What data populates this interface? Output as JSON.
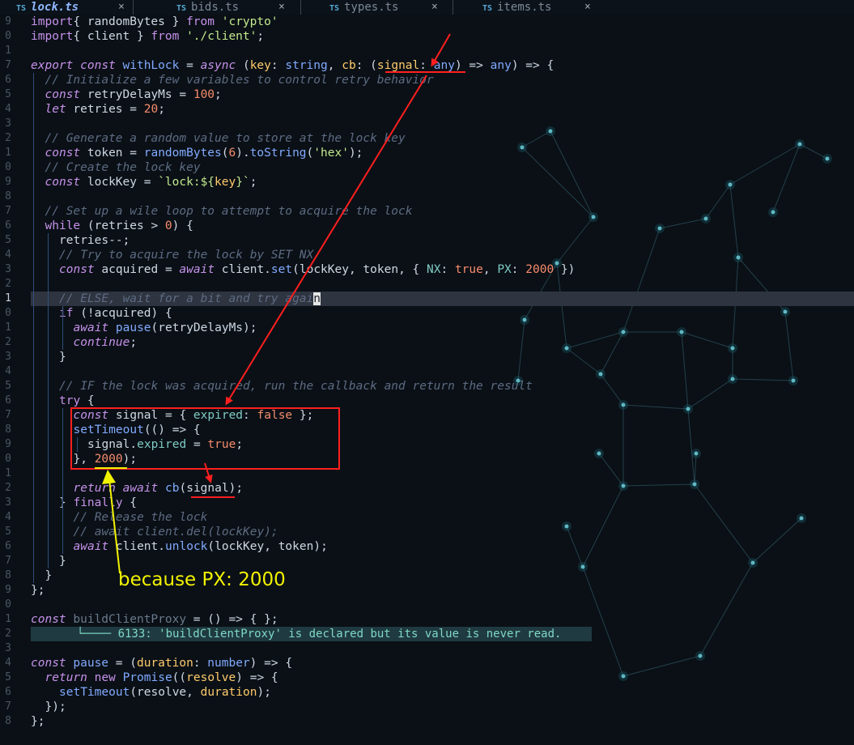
{
  "tabs": [
    {
      "badge": "TS",
      "name": "lock.ts",
      "close": "×",
      "active": true
    },
    {
      "badge": "TS",
      "name": "bids.ts",
      "close": "×",
      "active": false
    },
    {
      "badge": "TS",
      "name": "types.ts",
      "close": "×",
      "active": false
    },
    {
      "badge": "TS",
      "name": "items.ts",
      "close": "×",
      "active": false
    }
  ],
  "gutter": [
    "9",
    "0",
    "1",
    "7",
    "6",
    "5",
    "4",
    "3",
    "2",
    "1",
    "0",
    "9",
    "8",
    "7",
    "6",
    "5",
    "4",
    "3",
    "2",
    "1",
    "0",
    "1",
    "2",
    "3",
    "4",
    "5",
    "6",
    "7",
    "8",
    "9",
    "0",
    "1",
    "2",
    "3",
    "4",
    "5",
    "6",
    "7",
    "8",
    "9",
    "0",
    "1",
    "2",
    "3",
    "4",
    "5",
    "6",
    "7",
    "8"
  ],
  "code_lines": [
    [
      [
        "kw",
        "import"
      ],
      [
        "",
        "{ randomBytes } "
      ],
      [
        "kw",
        "from"
      ],
      [
        "",
        " "
      ],
      [
        "s",
        "'crypto'"
      ]
    ],
    [
      [
        "kw",
        "import"
      ],
      [
        "",
        "{ client } "
      ],
      [
        "kw",
        "from"
      ],
      [
        "",
        " "
      ],
      [
        "s",
        "'./client'"
      ],
      [
        "",
        ";"
      ]
    ],
    [],
    [
      [
        "k",
        "export"
      ],
      [
        "",
        " "
      ],
      [
        "k",
        "const"
      ],
      [
        "",
        " "
      ],
      [
        "f",
        "withLock"
      ],
      [
        "",
        " = "
      ],
      [
        "k",
        "async"
      ],
      [
        "",
        " ("
      ],
      [
        "p",
        "key"
      ],
      [
        "",
        ": "
      ],
      [
        "t",
        "string"
      ],
      [
        "",
        ", "
      ],
      [
        "p",
        "cb"
      ],
      [
        "",
        ": ("
      ],
      [
        "p",
        "signal"
      ],
      [
        "",
        ": "
      ],
      [
        "t",
        "any"
      ],
      [
        "",
        ") => "
      ],
      [
        "t",
        "any"
      ],
      [
        "",
        ") => {"
      ]
    ],
    [
      [
        "c",
        "// Initialize a few variables to control retry behavior"
      ]
    ],
    [
      [
        "k",
        "const"
      ],
      [
        "",
        " retryDelayMs = "
      ],
      [
        "n",
        "100"
      ],
      [
        "",
        ";"
      ]
    ],
    [
      [
        "k",
        "let"
      ],
      [
        "",
        " retries = "
      ],
      [
        "n",
        "20"
      ],
      [
        "",
        ";"
      ]
    ],
    [],
    [
      [
        "c",
        "// Generate a random value to store at the lock key"
      ]
    ],
    [
      [
        "k",
        "const"
      ],
      [
        "",
        " token = "
      ],
      [
        "f",
        "randomBytes"
      ],
      [
        "",
        "("
      ],
      [
        "n",
        "6"
      ],
      [
        "",
        ")."
      ],
      [
        "f",
        "toString"
      ],
      [
        "",
        "("
      ],
      [
        "s",
        "'hex'"
      ],
      [
        "",
        ");"
      ]
    ],
    [
      [
        "c",
        "// Create the lock key"
      ]
    ],
    [
      [
        "k",
        "const"
      ],
      [
        "",
        " lockKey = "
      ],
      [
        "s",
        "`lock:${"
      ],
      [
        "p",
        "key"
      ],
      [
        "s",
        "}`"
      ],
      [
        "",
        ";"
      ]
    ],
    [],
    [
      [
        "c",
        "// Set up a wile loop to attempt to acquire the lock"
      ]
    ],
    [
      [
        "kw",
        "while"
      ],
      [
        "",
        " (retries > "
      ],
      [
        "n",
        "0"
      ],
      [
        "",
        ") {"
      ]
    ],
    [
      [
        "",
        "retries--;"
      ]
    ],
    [
      [
        "c",
        "// Try to acquire the lock by SET NX"
      ]
    ],
    [
      [
        "k",
        "const"
      ],
      [
        "",
        " acquired = "
      ],
      [
        "k",
        "await"
      ],
      [
        "",
        " client."
      ],
      [
        "f",
        "set"
      ],
      [
        "",
        "(lockKey, token, { "
      ],
      [
        "pr",
        "NX"
      ],
      [
        "",
        ": "
      ],
      [
        "n",
        "true"
      ],
      [
        "",
        ", "
      ],
      [
        "pr",
        "PX"
      ],
      [
        "",
        ": "
      ],
      [
        "n",
        "2000"
      ],
      [
        "",
        " })"
      ]
    ],
    [],
    [
      [
        "c",
        "// ELSE, wait for a bit and try agai"
      ],
      [
        "cursor",
        "n"
      ]
    ],
    [
      [
        "kw",
        "if"
      ],
      [
        "",
        " (!acquired) {"
      ]
    ],
    [
      [
        "k",
        "await"
      ],
      [
        "",
        " "
      ],
      [
        "f",
        "pause"
      ],
      [
        "",
        "(retryDelayMs);"
      ]
    ],
    [
      [
        "k",
        "continue"
      ],
      [
        "",
        ";"
      ]
    ],
    [
      [
        "",
        "}"
      ]
    ],
    [],
    [
      [
        "c",
        "// IF the lock was acquired, run the callback and return the result"
      ]
    ],
    [
      [
        "kw",
        "try"
      ],
      [
        "",
        " {"
      ]
    ],
    [
      [
        "k",
        "const"
      ],
      [
        "",
        " signal = { "
      ],
      [
        "pr",
        "expired"
      ],
      [
        "",
        ": "
      ],
      [
        "n",
        "false"
      ],
      [
        "",
        " };"
      ]
    ],
    [
      [
        "f",
        "setTimeout"
      ],
      [
        "",
        "(() => {"
      ]
    ],
    [
      [
        "",
        "signal."
      ],
      [
        "pr",
        "expired"
      ],
      [
        "",
        " = "
      ],
      [
        "n",
        "true"
      ],
      [
        "",
        ";"
      ]
    ],
    [
      [
        "",
        "}, "
      ],
      [
        "n",
        "2000"
      ],
      [
        "",
        ");"
      ]
    ],
    [],
    [
      [
        "k",
        "return"
      ],
      [
        "",
        " "
      ],
      [
        "k",
        "await"
      ],
      [
        "",
        " "
      ],
      [
        "f",
        "cb"
      ],
      [
        "",
        "(signal);"
      ]
    ],
    [
      [
        "",
        "} "
      ],
      [
        "kw",
        "finally"
      ],
      [
        "",
        " {"
      ]
    ],
    [
      [
        "c",
        "// Release the lock"
      ]
    ],
    [
      [
        "c",
        "// await client.del(lockKey);"
      ]
    ],
    [
      [
        "k",
        "await"
      ],
      [
        "",
        " client."
      ],
      [
        "f",
        "unlock"
      ],
      [
        "",
        "(lockKey, token);"
      ]
    ],
    [
      [
        "",
        "}"
      ]
    ],
    [
      [
        "",
        "}"
      ]
    ],
    [
      [
        "",
        "};"
      ]
    ],
    [],
    [
      [
        "k",
        "const"
      ],
      [
        "",
        " "
      ],
      [
        "faded",
        "buildClientProxy"
      ],
      [
        "",
        " = () => { };"
      ]
    ],
    [],
    [],
    [
      [
        "k",
        "const"
      ],
      [
        "",
        " "
      ],
      [
        "f",
        "pause"
      ],
      [
        "",
        " = ("
      ],
      [
        "p",
        "duration"
      ],
      [
        "",
        ": "
      ],
      [
        "t",
        "number"
      ],
      [
        "",
        ") => {"
      ]
    ],
    [
      [
        "k",
        "return"
      ],
      [
        "",
        " "
      ],
      [
        "kw",
        "new"
      ],
      [
        "",
        " "
      ],
      [
        "f",
        "Promise"
      ],
      [
        "",
        "(("
      ],
      [
        "p",
        "resolve"
      ],
      [
        "",
        ") => {"
      ]
    ],
    [
      [
        "f",
        "setTimeout"
      ],
      [
        "",
        "(resolve, "
      ],
      [
        "p",
        "duration"
      ],
      [
        "",
        ");"
      ]
    ],
    [
      [
        "",
        "});"
      ]
    ],
    [
      [
        "",
        "};"
      ]
    ]
  ],
  "diagnostic": {
    "prefix": "└──── ",
    "message": "6133: 'buildClientProxy' is declared but its value is never read."
  },
  "annotation": {
    "text": "because PX: 2000"
  },
  "colors": {
    "arrow": "#ff1f1f",
    "box": "#ff1f1f",
    "yellow": "#f2f200",
    "underline": "#ff1f1f"
  }
}
